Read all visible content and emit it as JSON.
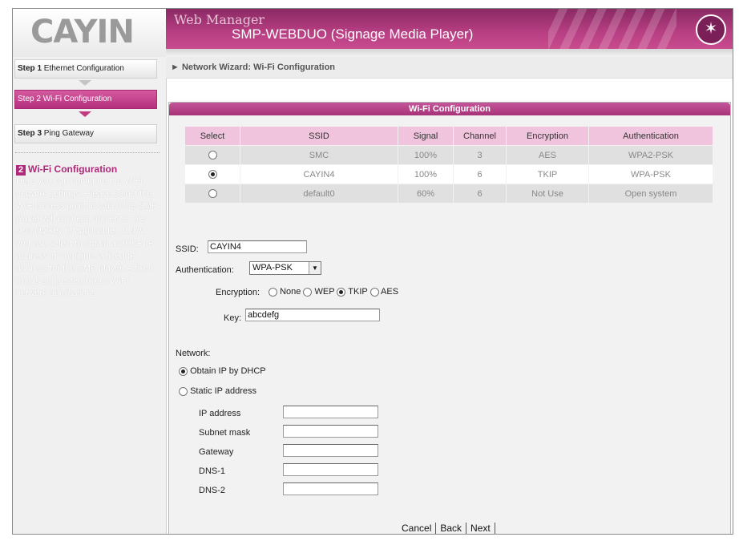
{
  "header": {
    "logo_text": "CAYIN",
    "app_name": "Web Manager",
    "product": "SMP-WEBDUO (Signage Media Player)"
  },
  "sidebar": {
    "steps": [
      {
        "num": "Step 1",
        "label": "Ethernet Configuration"
      },
      {
        "num": "Step 2",
        "label": "Wi-Fi Configuration"
      },
      {
        "num": "Step 3",
        "label": "Ping Gateway"
      }
    ],
    "help_number": "2",
    "help_title": "Wi-Fi Configuration",
    "help_text": "Here you can configure the WIFI network settings. Please select the WIFI access point to which the SMP player will connect, and enter the security key (if applicable). Below you can select to obtain a DHCP IP address or configure a fixed IP address for the SMP player. A fixed one is suggested under WIFI network applications."
  },
  "breadcrumb": "► Network Wizard: Wi-Fi Configuration",
  "panel": {
    "title": "Wi-Fi Configuration",
    "table": {
      "headers": [
        "Select",
        "SSID",
        "Signal",
        "Channel",
        "Encryption",
        "Authentication"
      ],
      "rows": [
        {
          "selected": false,
          "ssid": "SMC",
          "signal": "100%",
          "channel": "3",
          "encryption": "AES",
          "auth": "WPA2-PSK"
        },
        {
          "selected": true,
          "ssid": "CAYIN4",
          "signal": "100%",
          "channel": "6",
          "encryption": "TKIP",
          "auth": "WPA-PSK"
        },
        {
          "selected": false,
          "ssid": "default0",
          "signal": "60%",
          "channel": "6",
          "encryption": "Not Use",
          "auth": "Open system"
        }
      ]
    },
    "ssid_label": "SSID:",
    "ssid_value": "CAYIN4",
    "auth_label": "Authentication:",
    "auth_value": "WPA-PSK",
    "encryption_label": "Encryption:",
    "encryption_options": [
      "None",
      "WEP",
      "TKIP",
      "AES"
    ],
    "encryption_selected": "TKIP",
    "key_label": "Key:",
    "key_value": "abcdefg",
    "network_label": "Network:",
    "dhcp_label": "Obtain IP by DHCP",
    "static_label": "Static IP address",
    "ip_fields": [
      "IP address",
      "Subnet mask",
      "Gateway",
      "DNS-1",
      "DNS-2"
    ]
  },
  "buttons": {
    "cancel": "Cancel",
    "back": "Back",
    "next": "Next"
  }
}
